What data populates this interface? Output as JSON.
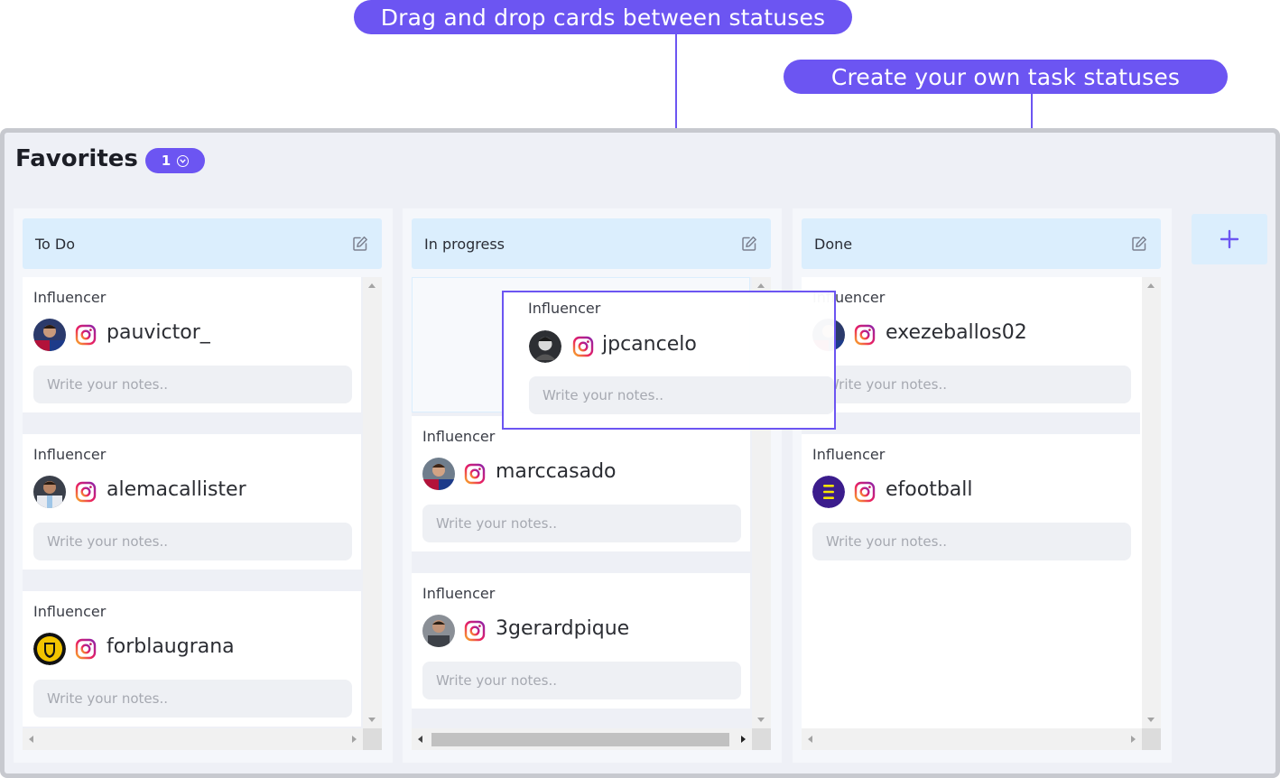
{
  "callouts": {
    "drag": "Drag and drop cards between statuses",
    "create": "Create your own task statuses"
  },
  "board": {
    "title": "Favorites",
    "badge_count": "1"
  },
  "columns": [
    {
      "title": "To Do",
      "cards": [
        {
          "kind": "Influencer",
          "handle": "pauvictor_",
          "avatar": "player-red-blue",
          "notes_placeholder": "Write your notes.."
        },
        {
          "kind": "Influencer",
          "handle": "alemacallister",
          "avatar": "player-white-jersey",
          "notes_placeholder": "Write your notes.."
        },
        {
          "kind": "Influencer",
          "handle": "forblaugrana",
          "avatar": "club-crest-yellow",
          "notes_placeholder": "Write your notes.."
        }
      ]
    },
    {
      "title": "In progress",
      "cards": [
        {
          "kind": "Influencer",
          "handle": "marccasado",
          "avatar": "player-red-blue",
          "notes_placeholder": "Write your notes.."
        },
        {
          "kind": "Influencer",
          "handle": "3gerardpique",
          "avatar": "person-dark",
          "notes_placeholder": "Write your notes.."
        }
      ]
    },
    {
      "title": "Done",
      "cards": [
        {
          "kind": "Influencer",
          "handle": "exezeballos02",
          "avatar": "player-red-blue",
          "notes_placeholder": "Write your notes.."
        },
        {
          "kind": "Influencer",
          "handle": "efootball",
          "avatar": "efootball-logo",
          "notes_placeholder": "Write your notes.."
        }
      ]
    }
  ],
  "dragging_card": {
    "kind": "Influencer",
    "handle": "jpcancelo",
    "avatar": "person-grey",
    "notes_placeholder": "Write your notes.."
  },
  "icons": {
    "platform": "instagram-icon",
    "edit": "pencil-edit-icon",
    "add": "plus-icon",
    "badge": "chevron-down-circle-icon"
  },
  "colors": {
    "accent": "#6c55f2",
    "column_header": "#dbeefd",
    "board_bg": "#eef0f6"
  }
}
